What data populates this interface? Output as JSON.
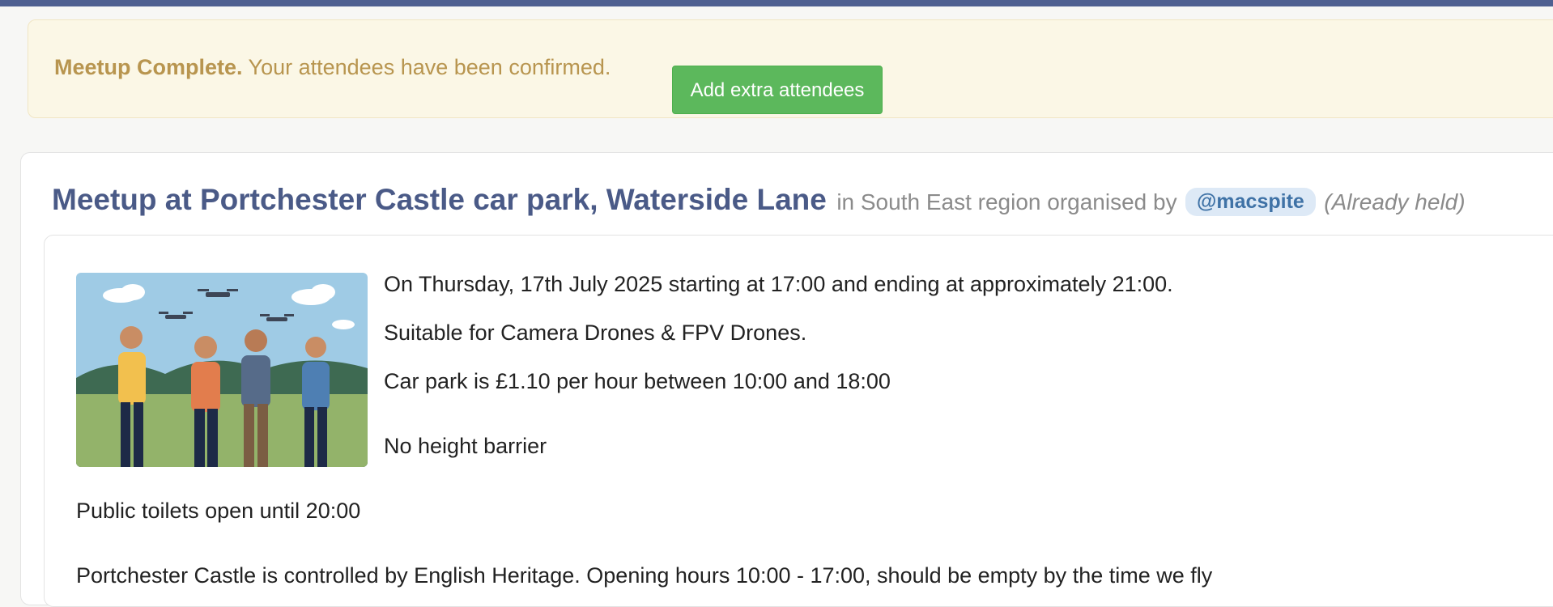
{
  "alert": {
    "strong": "Meetup Complete.",
    "message": "Your attendees have been confirmed.",
    "button_label": "Add extra attendees"
  },
  "meetup": {
    "title": "Meetup at Portchester Castle car park, Waterside Lane",
    "region_text": "in South East region organised by",
    "organiser": "@macspite",
    "status": "(Already held)",
    "details": {
      "date_line": "On Thursday, 17th July 2025 starting at 17:00 and ending at approximately 21:00.",
      "suitable_line": "Suitable for Camera Drones & FPV Drones.",
      "car_park_line": "Car park is £1.10 per hour between 10:00 and 18:00",
      "barrier_line": "No height barrier",
      "toilets_line": "Public toilets open until 20:00",
      "castle_line": "Portchester Castle is controlled by English Heritage. Opening hours 10:00 - 17:00, should be empty by the time we fly"
    }
  },
  "colors": {
    "top_bar": "#4f6091",
    "alert_bg": "#fbf7e6",
    "alert_text": "#b8954f",
    "button": "#5cb85c",
    "title": "#4a5a87",
    "organiser_badge_bg": "#dde9f6"
  }
}
